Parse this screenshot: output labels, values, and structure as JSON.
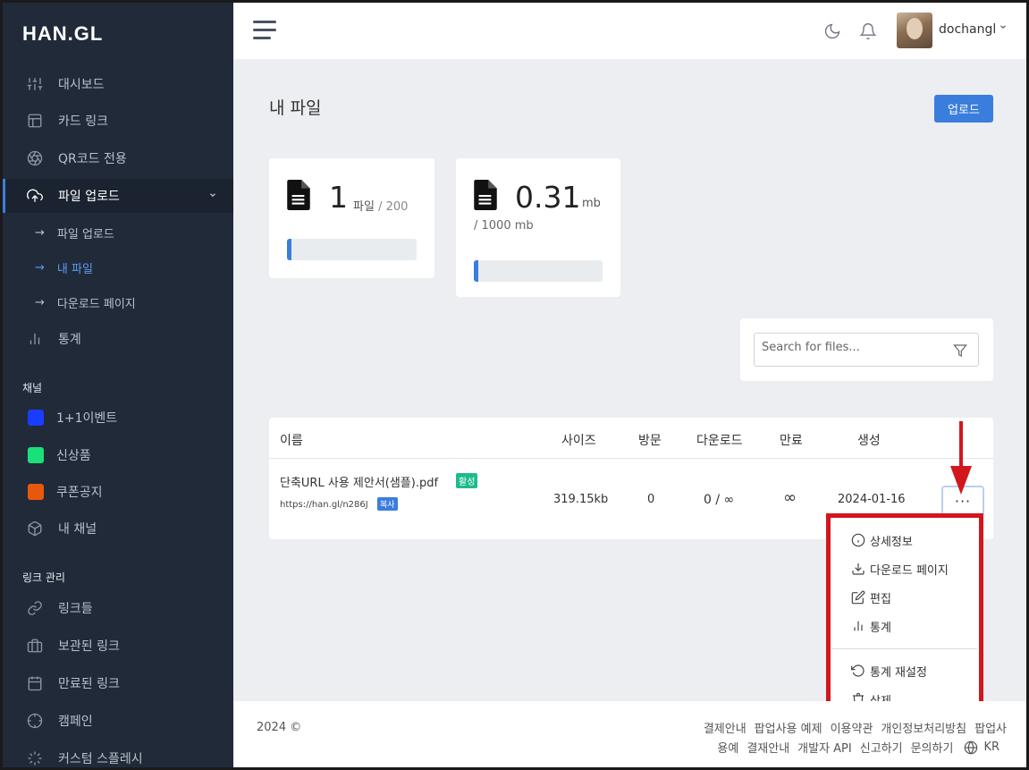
{
  "brand": {
    "logo": "HAN.GL"
  },
  "sidebar": {
    "items": [
      {
        "label": "대시보드",
        "icon": "sliders-icon"
      },
      {
        "label": "카드 링크",
        "icon": "layout-icon"
      },
      {
        "label": "QR코드 전용",
        "icon": "aperture-icon"
      },
      {
        "label": "파일 업로드",
        "icon": "upload-cloud-icon",
        "active": true
      }
    ],
    "sub_items": [
      {
        "label": "파일 업로드"
      },
      {
        "label": "내 파일",
        "current": true
      },
      {
        "label": "다운로드 페이지"
      }
    ],
    "stats_item": {
      "label": "통계",
      "icon": "bar-chart-icon"
    },
    "channel_section": "채널",
    "channels": [
      {
        "label": "1+1이벤트",
        "color": "#1a3cff"
      },
      {
        "label": "신상품",
        "color": "#1ae07a"
      },
      {
        "label": "쿠폰공지",
        "color": "#e8580c"
      },
      {
        "label": "내 채널",
        "icon": "box-icon"
      }
    ],
    "link_section": "링크 관리",
    "link_items": [
      {
        "label": "링크들",
        "icon": "link-icon"
      },
      {
        "label": "보관된 링크",
        "icon": "briefcase-icon"
      },
      {
        "label": "만료된 링크",
        "icon": "calendar-icon"
      },
      {
        "label": "캠페인",
        "icon": "crosshair-icon"
      },
      {
        "label": "커스텀 스플레시",
        "icon": "loader-icon"
      }
    ]
  },
  "topbar": {
    "username": "dochangl"
  },
  "main": {
    "page_title": "내 파일",
    "upload_label": "업로드",
    "cards": {
      "files": {
        "value": "1",
        "unit": "파일",
        "limit": "/ 200",
        "progress": 0.005
      },
      "storage": {
        "value": "0.31",
        "unit": "mb",
        "limit": "/ 1000 mb",
        "progress": 0.0003
      }
    },
    "search_placeholder": "Search for files...",
    "table": {
      "headers": {
        "name": "이름",
        "size": "사이즈",
        "visits": "방문",
        "downloads": "다운로드",
        "expiry": "만료",
        "created": "생성"
      },
      "row": {
        "name": "단축URL 사용 제안서(샘플).pdf",
        "status": "활성",
        "url": "https://han.gl/n286J",
        "copy": "복사",
        "size": "319.15kb",
        "visits": "0",
        "downloads": "0 / ∞",
        "expiry": "∞",
        "created": "2024-01-16",
        "more": "···"
      }
    },
    "menu": {
      "details": "상세정보",
      "download_page": "다운로드 페이지",
      "edit": "편집",
      "stats": "통계",
      "reset_stats": "통계 재설정",
      "delete": "삭제"
    }
  },
  "footer": {
    "copyright": "2024 ©",
    "links_row1": [
      "결제안내",
      "팝업사용 예제",
      "이용약관",
      "개인정보처리방침",
      "팝업사"
    ],
    "links_row2": [
      "용예",
      "결재안내",
      "개발자 API",
      "신고하기",
      "문의하기"
    ],
    "language": "KR"
  },
  "colors": {
    "sidebar_bg": "#212a39",
    "accent": "#3b7ddd",
    "active_badge": "#1cbb8c",
    "annotation_red": "#d2161e"
  }
}
